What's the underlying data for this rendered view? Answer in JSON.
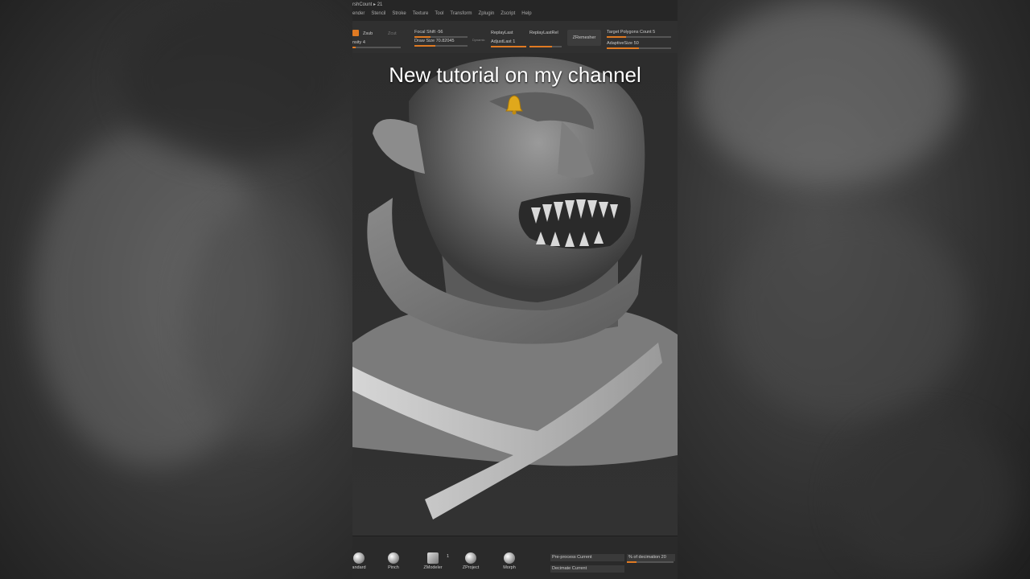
{
  "menubar": {
    "brush_count": "rshCount ▸ 21",
    "menus": [
      "ender",
      "Stencil",
      "Stroke",
      "Texture",
      "Tool",
      "Transform",
      "Zplugin",
      "Zscript",
      "Help"
    ]
  },
  "toolbar": {
    "zsub_label": "Zsub",
    "zcut_label": "Zcut",
    "intensity_label": "nsity 4",
    "focal_shift": "Focal Shift -56",
    "draw_size": "Draw Size 70.82045",
    "dynamic_label": "Dynamic",
    "replay_last": "ReplayLast",
    "adjust_last": "AdjustLast 1",
    "replay_last_rel": "ReplayLastRel",
    "zremesher": "ZRemesher",
    "target_polygons": "Target Polygons Count 5",
    "adaptive_size": "AdaptiveSize 50"
  },
  "caption": "New tutorial on my channel",
  "bottombar": {
    "brushes": [
      {
        "label": "andard"
      },
      {
        "label": "Pinch"
      },
      {
        "label": "ZModeler",
        "badge": "1"
      },
      {
        "label": "ZProject"
      },
      {
        "label": "Morph"
      }
    ],
    "pre_process": "Pre-process Current",
    "decimate": "Decimate Current",
    "pct_decimation": "% of decimation 20"
  },
  "colors": {
    "accent": "#e07a22",
    "viewport": "#2d2d2d"
  },
  "icons": [
    "bell-icon"
  ]
}
